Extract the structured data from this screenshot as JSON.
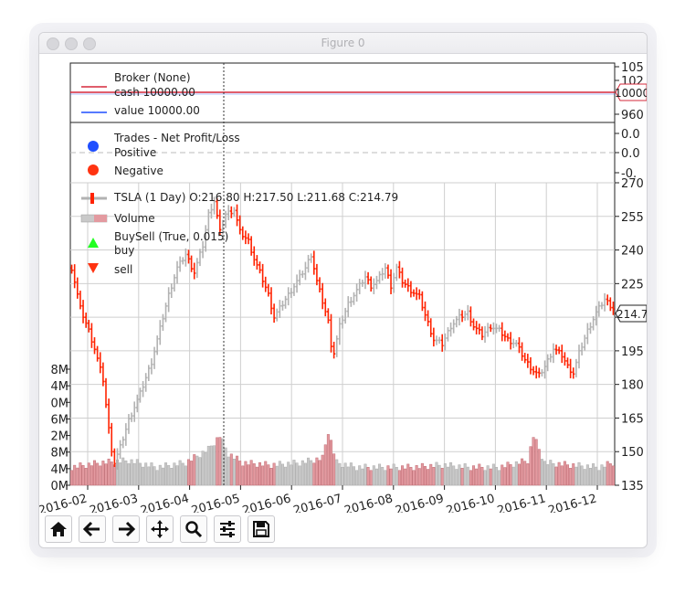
{
  "window": {
    "title": "Figure 0"
  },
  "toolbar": [
    "home-icon",
    "back-icon",
    "forward-icon",
    "pan-icon",
    "zoom-icon",
    "configure-subplots-icon",
    "save-icon"
  ],
  "colors": {
    "up": "#b2b2b2",
    "down": "#ff2200",
    "cash": "#d6283b",
    "value": "#1f4fff",
    "positive": "#1f4fff",
    "negative": "#ff3311",
    "buy": "#22ff22",
    "sell": "#ff3311",
    "vol_up": "#c9c9c9",
    "vol_down": "#e39aa0"
  },
  "chart_data": [
    {
      "type": "line",
      "legend_title": "Broker (None)",
      "series": [
        {
          "name": "cash 10000.00",
          "values": [
            10000
          ]
        },
        {
          "name": "value 10000.00",
          "values": [
            10000
          ]
        }
      ],
      "yticks": [
        "105",
        "102",
        "1000",
        "960"
      ],
      "last_value_label": "10000"
    },
    {
      "type": "scatter",
      "legend_title": "Trades - Net Profit/Loss",
      "series": [
        {
          "name": "Positive",
          "values": []
        },
        {
          "name": "Negative",
          "values": []
        }
      ],
      "yticks": [
        "0.0",
        "0.0",
        "-0."
      ]
    },
    {
      "type": "line",
      "legend": [
        "TSLA (1 Day) O:216.80 H:217.50 L:211.68 C:214.79",
        "Volume",
        "BuySell (True, 0.015)",
        "buy",
        "sell"
      ],
      "yticks": [
        "270",
        "255",
        "240",
        "225",
        "210",
        "195",
        "180",
        "165",
        "150",
        "135"
      ],
      "ylim": [
        135,
        270
      ],
      "last_price_label": "214.7",
      "volume_yticks": [
        "8M",
        "4M",
        "0M",
        "6M",
        "2M",
        "8M",
        "4M",
        "0M"
      ],
      "xticks": [
        "2016-02",
        "2016-03",
        "2016-04",
        "2016-05",
        "2016-06",
        "2016-07",
        "2016-08",
        "2016-09",
        "2016-10",
        "2016-11",
        "2016-12"
      ],
      "volume_scale": 16,
      "close_keypoints": [
        [
          0,
          232
        ],
        [
          3,
          214
        ],
        [
          6,
          204
        ],
        [
          8,
          196
        ],
        [
          11,
          182
        ],
        [
          13,
          160
        ],
        [
          14,
          151
        ],
        [
          15,
          145
        ],
        [
          17,
          152
        ],
        [
          20,
          164
        ],
        [
          24,
          176
        ],
        [
          28,
          190
        ],
        [
          31,
          205
        ],
        [
          34,
          220
        ],
        [
          37,
          232
        ],
        [
          40,
          238
        ],
        [
          43,
          230
        ],
        [
          46,
          242
        ],
        [
          48,
          256
        ],
        [
          50,
          262
        ],
        [
          52,
          248
        ],
        [
          54,
          256
        ],
        [
          57,
          258
        ],
        [
          59,
          248
        ],
        [
          62,
          244
        ],
        [
          64,
          236
        ],
        [
          66,
          230
        ],
        [
          69,
          220
        ],
        [
          71,
          210
        ],
        [
          73,
          214
        ],
        [
          76,
          220
        ],
        [
          79,
          226
        ],
        [
          82,
          232
        ],
        [
          84,
          238
        ],
        [
          86,
          226
        ],
        [
          88,
          217
        ],
        [
          90,
          208
        ],
        [
          91,
          198
        ],
        [
          92,
          194
        ],
        [
          94,
          206
        ],
        [
          97,
          216
        ],
        [
          100,
          222
        ],
        [
          103,
          228
        ],
        [
          105,
          224
        ],
        [
          107,
          226
        ],
        [
          110,
          232
        ],
        [
          112,
          224
        ],
        [
          114,
          232
        ],
        [
          116,
          226
        ],
        [
          119,
          222
        ],
        [
          122,
          219
        ],
        [
          124,
          211
        ],
        [
          127,
          200
        ],
        [
          130,
          198
        ],
        [
          133,
          206
        ],
        [
          136,
          210
        ],
        [
          139,
          212
        ],
        [
          141,
          206
        ],
        [
          144,
          202
        ],
        [
          147,
          206
        ],
        [
          150,
          204
        ],
        [
          153,
          200
        ],
        [
          156,
          198
        ],
        [
          159,
          191
        ],
        [
          162,
          186
        ],
        [
          164,
          184
        ],
        [
          166,
          188
        ],
        [
          169,
          196
        ],
        [
          172,
          193
        ],
        [
          174,
          188
        ],
        [
          176,
          185
        ],
        [
          178,
          194
        ],
        [
          181,
          204
        ],
        [
          184,
          212
        ],
        [
          187,
          218
        ],
        [
          190,
          214
        ]
      ],
      "volume_keypoints": [
        [
          0,
          4
        ],
        [
          10,
          5
        ],
        [
          20,
          5.5
        ],
        [
          30,
          4
        ],
        [
          40,
          5
        ],
        [
          48,
          8
        ],
        [
          52,
          11
        ],
        [
          55,
          7
        ],
        [
          60,
          5
        ],
        [
          70,
          4.5
        ],
        [
          80,
          5
        ],
        [
          88,
          6
        ],
        [
          90,
          12
        ],
        [
          93,
          5
        ],
        [
          100,
          4
        ],
        [
          110,
          4
        ],
        [
          120,
          4
        ],
        [
          130,
          4.5
        ],
        [
          140,
          4
        ],
        [
          150,
          4
        ],
        [
          160,
          5.5
        ],
        [
          162,
          11
        ],
        [
          166,
          5
        ],
        [
          175,
          4.5
        ],
        [
          185,
          4
        ],
        [
          190,
          5
        ]
      ]
    }
  ]
}
